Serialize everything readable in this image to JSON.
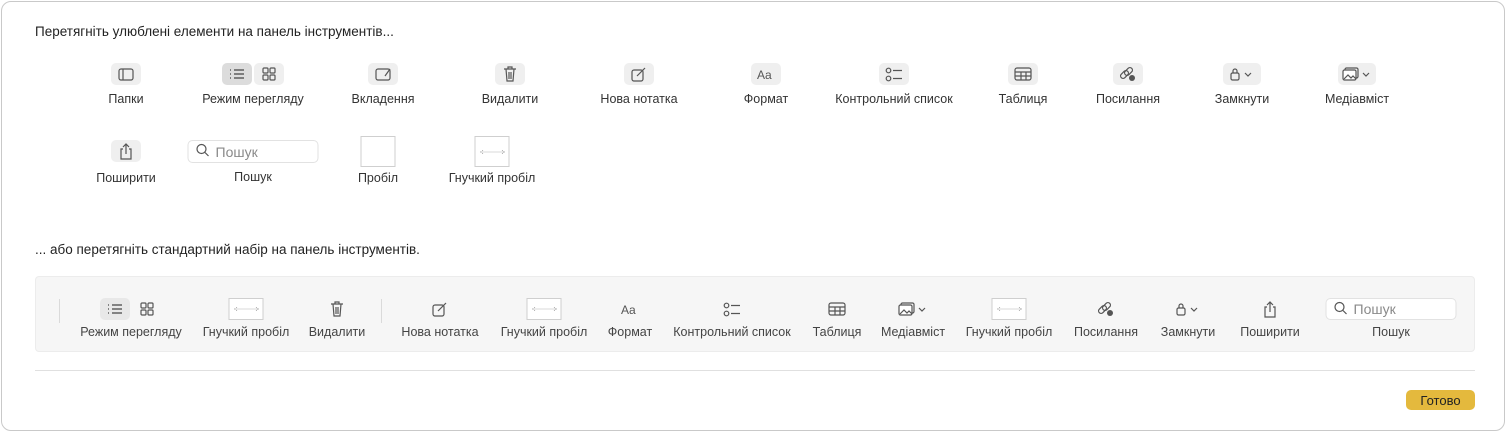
{
  "palette_heading": "Перетягніть улюблені елементи на панель інструментів...",
  "default_heading": "... або перетягніть стандартний набір на панель інструментів.",
  "palette": [
    {
      "label": "Папки",
      "icon": "sidebar-icon"
    },
    {
      "label": "Режим перегляду",
      "icon": "view-mode-icon"
    },
    {
      "label": "Вкладення",
      "icon": "attachment-icon"
    },
    {
      "label": "Видалити",
      "icon": "trash-icon"
    },
    {
      "label": "Нова нотатка",
      "icon": "compose-icon"
    },
    {
      "label": "Формат",
      "icon": "format-icon"
    },
    {
      "label": "Контрольний список",
      "icon": "checklist-icon"
    },
    {
      "label": "Таблиця",
      "icon": "table-icon"
    },
    {
      "label": "Посилання",
      "icon": "link-icon"
    },
    {
      "label": "Замкнути",
      "icon": "lock-icon"
    },
    {
      "label": "Медіавміст",
      "icon": "media-icon"
    },
    {
      "label": "Поширити",
      "icon": "share-icon"
    },
    {
      "label": "Пошук",
      "icon": "search-field",
      "placeholder": "Пошук"
    },
    {
      "label": "Пробіл",
      "icon": "space"
    },
    {
      "label": "Гнучкий пробіл",
      "icon": "flex-space"
    }
  ],
  "default_set": [
    {
      "label": "Режим перегляду",
      "icon": "view-mode-icon"
    },
    {
      "label": "Гнучкий пробіл",
      "icon": "flex-space"
    },
    {
      "label": "Видалити",
      "icon": "trash-icon"
    },
    {
      "label": "Нова нотатка",
      "icon": "compose-icon"
    },
    {
      "label": "Гнучкий пробіл",
      "icon": "flex-space"
    },
    {
      "label": "Формат",
      "icon": "format-icon"
    },
    {
      "label": "Контрольний список",
      "icon": "checklist-icon"
    },
    {
      "label": "Таблиця",
      "icon": "table-icon"
    },
    {
      "label": "Медіавміст",
      "icon": "media-icon"
    },
    {
      "label": "Гнучкий пробіл",
      "icon": "flex-space"
    },
    {
      "label": "Посилання",
      "icon": "link-icon"
    },
    {
      "label": "Замкнути",
      "icon": "lock-icon"
    },
    {
      "label": "Поширити",
      "icon": "share-icon"
    },
    {
      "label": "Пошук",
      "icon": "search-field",
      "placeholder": "Пошук"
    }
  ],
  "done_label": "Готово",
  "accent": "#e4b93d"
}
